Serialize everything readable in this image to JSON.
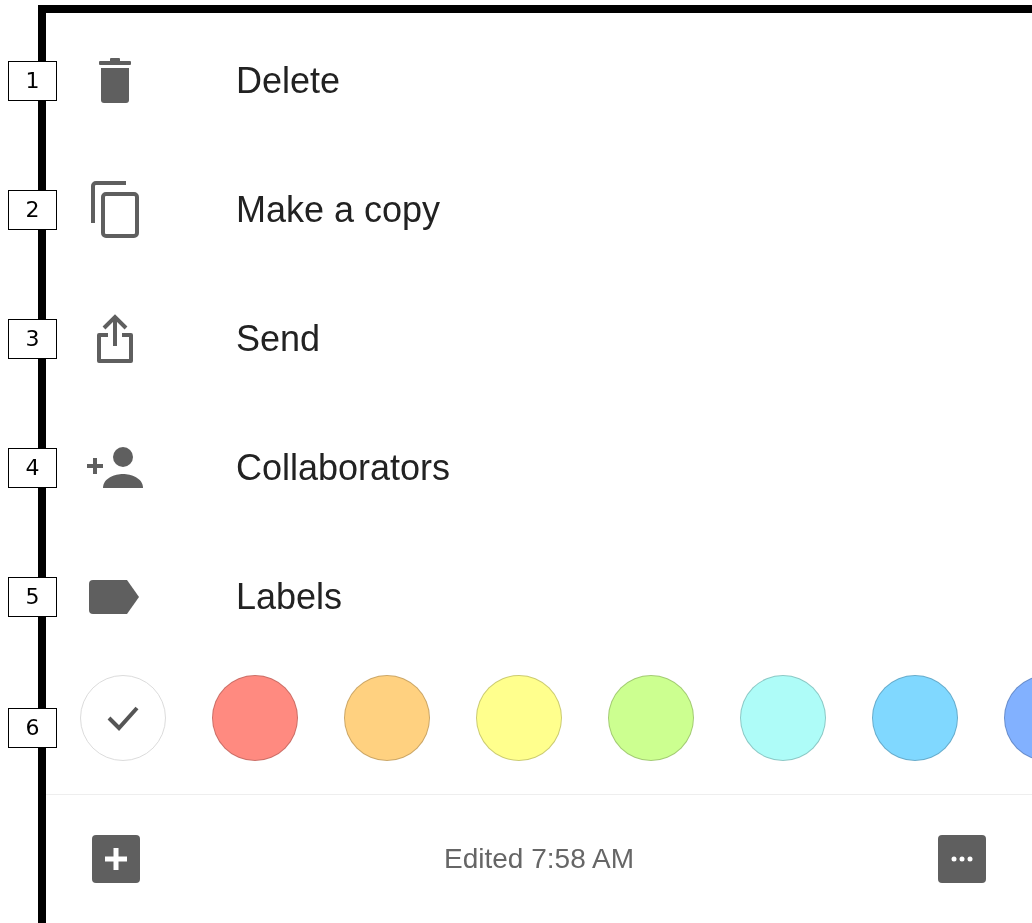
{
  "menu_items": [
    {
      "marker": "1",
      "label": "Delete"
    },
    {
      "marker": "2",
      "label": "Make a copy"
    },
    {
      "marker": "3",
      "label": "Send"
    },
    {
      "marker": "4",
      "label": "Collaborators"
    },
    {
      "marker": "5",
      "label": "Labels"
    }
  ],
  "color_row": {
    "marker": "6",
    "colors": [
      {
        "color": "#ffffff",
        "selected": true
      },
      {
        "color": "#ff8a80",
        "selected": false
      },
      {
        "color": "#ffd180",
        "selected": false
      },
      {
        "color": "#ffff8d",
        "selected": false
      },
      {
        "color": "#ccff90",
        "selected": false
      },
      {
        "color": "#aefcf8",
        "selected": false
      },
      {
        "color": "#80d8ff",
        "selected": false
      },
      {
        "color": "#82b1ff",
        "selected": false
      }
    ]
  },
  "footer": {
    "status": "Edited 7:58 AM"
  }
}
